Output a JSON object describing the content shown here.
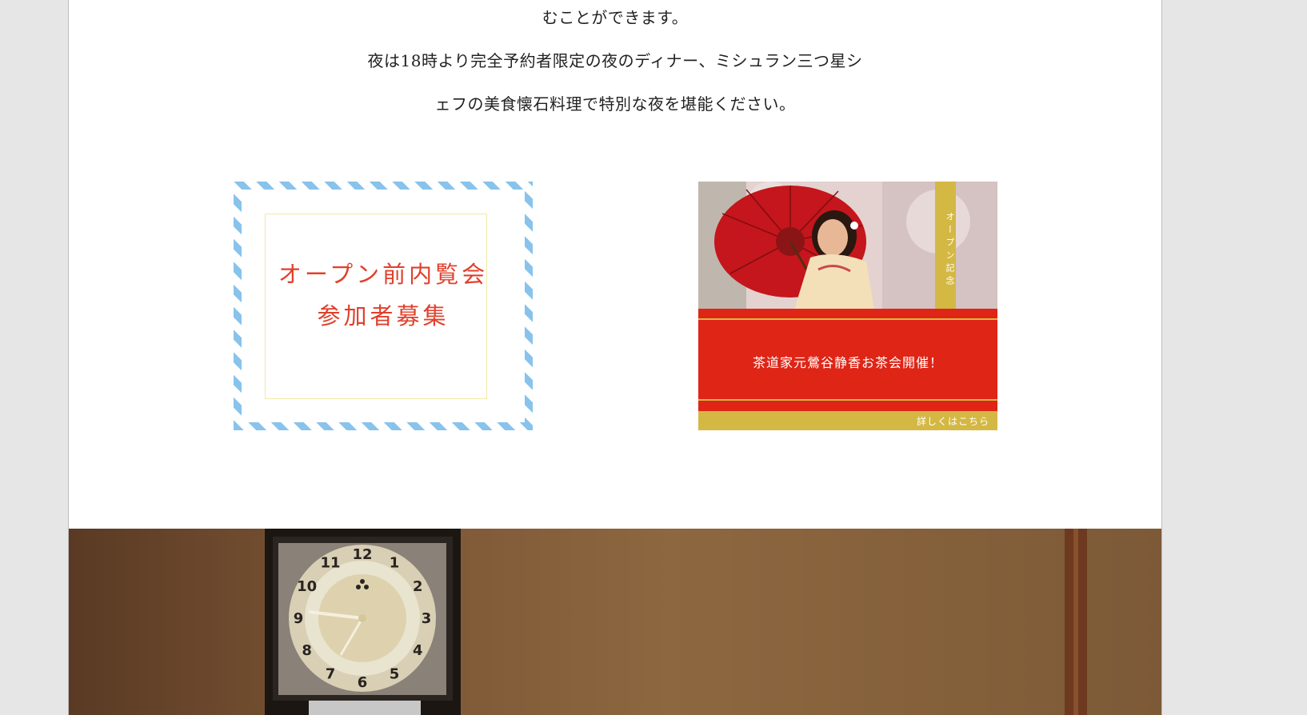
{
  "intro": {
    "lines": [
      "むことができます。",
      "夜は18時より完全予約者限定の夜のディナー、ミシュラン三つ星シ",
      "ェフの美食懐石料理で特別な夜を堪能ください。"
    ]
  },
  "banners": {
    "preview": {
      "line1": "オープン前内覧会",
      "line2": "参加者募集",
      "stripe_color": "#88c3ec",
      "text_color": "#e0402c"
    },
    "tea": {
      "ribbon": "オープン記念",
      "title": "茶道家元鶯谷静香お茶会開催！",
      "link": "詳しくはこちら",
      "red": "#de2516",
      "gold": "#d4b844"
    }
  },
  "bottom_image": {
    "clock_numbers": [
      "12",
      "1",
      "2",
      "3",
      "4",
      "5",
      "6",
      "7",
      "8",
      "9",
      "10",
      "11"
    ]
  }
}
